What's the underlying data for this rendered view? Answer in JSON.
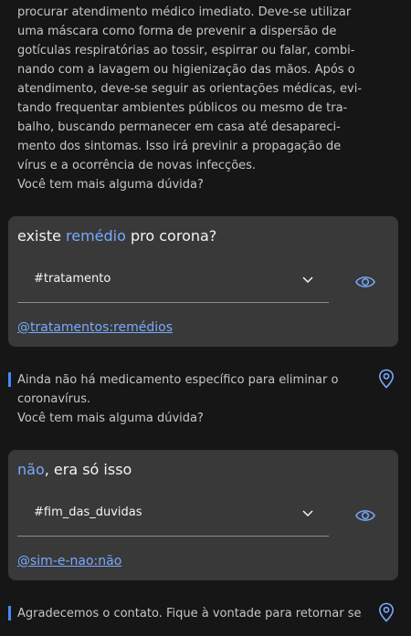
{
  "top_response": {
    "lines": [
      "procurar atendimento médico imediato. Deve-se utilizar",
      "uma máscara como forma de prevenir a dispersão de",
      "gotículas respiratórias ao tossir, espirrar ou falar, combi-",
      "nando com a lavagem ou higienização das mãos. Após o",
      "atendimento, deve-se seguir as orientações médicas, evi-",
      "tando frequentar ambientes públicos ou mesmo de tra-",
      "balho, buscando permanecer em casa até desapareci-",
      "mento dos sintomas. Isso irá previnir a propagação de",
      "vírus e a ocorrência de novas infecções.",
      "Você tem mais alguma dúvida?"
    ]
  },
  "cards": [
    {
      "question_before": "existe ",
      "question_highlight": "remédio",
      "question_after": " pro corona?",
      "intent": "#tratamento",
      "entity": "@tratamentos:remédios"
    },
    {
      "question_before": "",
      "question_highlight": "não",
      "question_after": ", era só isso",
      "intent": "#fim_das_duvidas",
      "entity": "@sim-e-nao:não"
    }
  ],
  "responses": [
    {
      "lines": [
        "Ainda não há medicamento específico para eliminar o",
        "coronavírus.",
        "Você tem mais alguma dúvida?"
      ]
    },
    {
      "lines": [
        "Agradecemos o contato. Fique à vontade para retornar se"
      ]
    }
  ],
  "colors": {
    "background": "#161616",
    "card": "#393939",
    "accent": "#78a9ff",
    "bar": "#4589ff"
  },
  "icons": {
    "eye": "eye-icon",
    "chevron": "chevron-down-icon",
    "pin": "location-pin-icon"
  }
}
